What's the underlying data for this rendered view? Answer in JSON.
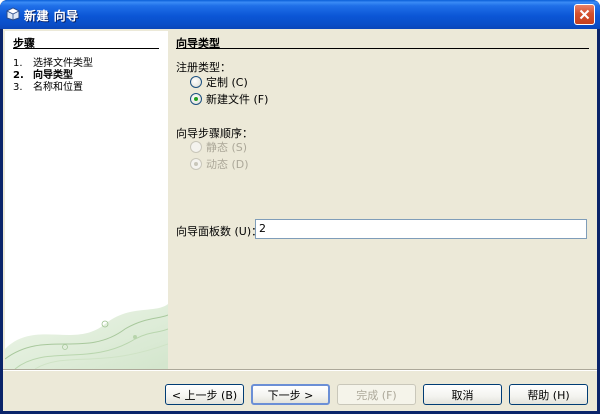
{
  "window": {
    "title": "新建 向导",
    "colors": {
      "titlebar": "#0a56d6",
      "frame": "#ece9d8",
      "close": "#d4512e"
    }
  },
  "steps": {
    "title": "步骤",
    "items": [
      {
        "num": "1.",
        "label": "选择文件类型",
        "current": false
      },
      {
        "num": "2.",
        "label": "向导类型",
        "current": true
      },
      {
        "num": "3.",
        "label": "名称和位置",
        "current": false
      }
    ]
  },
  "content": {
    "title": "向导类型",
    "registration": {
      "label": "注册类型：",
      "options": [
        {
          "label": "定制 (C)",
          "checked": false
        },
        {
          "label": "新建文件 (F)",
          "checked": true
        }
      ]
    },
    "order": {
      "label": "向导步骤顺序：",
      "options": [
        {
          "label": "静态 (S)",
          "checked": false,
          "disabled": true
        },
        {
          "label": "动态 (D)",
          "checked": true,
          "disabled": true
        }
      ]
    },
    "panel_count": {
      "label": "向导面板数 (U)：",
      "value": "2"
    }
  },
  "buttons": {
    "back": "< 上一步 (B)",
    "next": "下一步 >",
    "finish": "完成 (F)",
    "cancel": "取消",
    "help": "帮助 (H)"
  },
  "icons": [
    "app-icon",
    "close-icon",
    "decorative-swirl"
  ]
}
